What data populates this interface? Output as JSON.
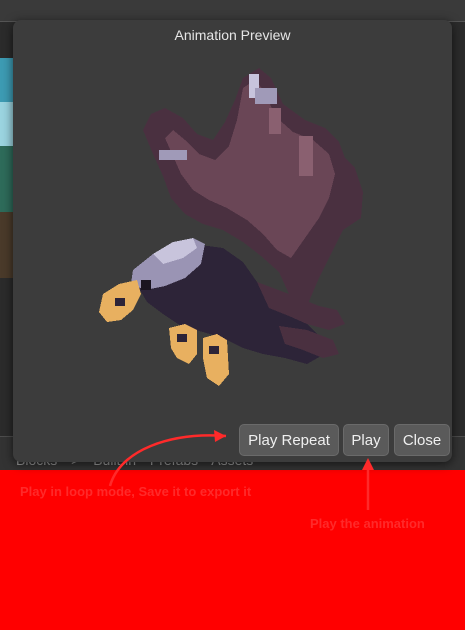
{
  "modal": {
    "title": "Animation Preview",
    "buttons": {
      "play_repeat": "Play Repeat",
      "play": "Play",
      "close": "Close"
    }
  },
  "background": {
    "breadcrumb": [
      "Blocks",
      ">",
      "Built-in",
      "Prefabs",
      "Assets"
    ]
  },
  "annotations": {
    "note_1": "Play in loop mode, Save it to export it",
    "note_2": "Play the animation"
  },
  "colors": {
    "annotation": "#ff2a2a",
    "background": "#ff0000",
    "modal": "#3c3c3c",
    "button": "#5a5a5a"
  },
  "icons": {
    "sprite": "eagle-sprite-icon"
  }
}
